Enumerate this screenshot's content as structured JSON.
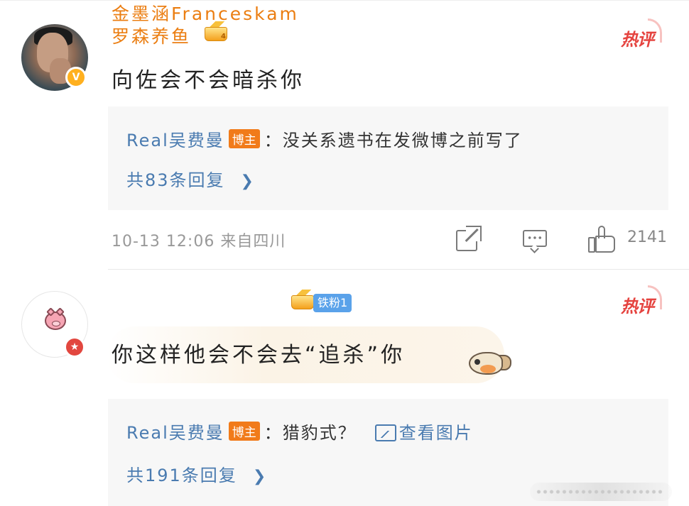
{
  "comments": [
    {
      "username": "罗森养鱼",
      "crown_level": "4",
      "hot_label": "热评",
      "content": "向佐会不会暗杀你",
      "reply": {
        "user": "Real吴费曼",
        "tag": "博主",
        "text": "：没关系遗书在发微博之前写了",
        "count_text": "共83条回复"
      },
      "meta": "10-13 12:06 来自四川",
      "like_count": "2141"
    },
    {
      "username": "金墨涵Franceskam",
      "fan_badge": "铁粉1",
      "hot_label": "热评",
      "content": "你这样他会不会去“追杀”你",
      "reply": {
        "user": "Real吴费曼",
        "tag": "博主",
        "text": "：猎豹式？",
        "pic_link": "查看图片",
        "count_text": "共191条回复"
      }
    }
  ],
  "icons": {
    "verified": "v-badge-icon",
    "share": "share-icon",
    "comment": "comment-icon",
    "like": "like-icon",
    "chevron": "chevron-right-icon",
    "image": "image-icon"
  },
  "colors": {
    "username": "#eb7e12",
    "link": "#4a7bb0",
    "hot": "#e5433f",
    "blogger_tag": "#f17b1a",
    "fan_badge": "#5aa2ea"
  }
}
